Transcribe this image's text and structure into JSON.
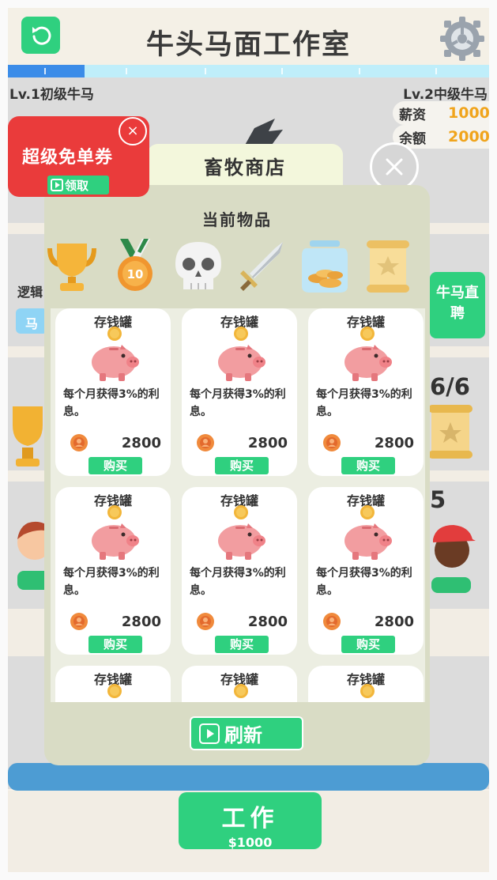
{
  "header": {
    "title": "牛头马面工作室",
    "back_icon": "undo-arrow-icon",
    "settings_icon": "gear-icon",
    "progress": 0.16
  },
  "levels": {
    "current": "Lv.1初级牛马",
    "next": "Lv.2中级牛马"
  },
  "stats": [
    {
      "label": "薪资",
      "value": "1000"
    },
    {
      "label": "余额",
      "value": "2000"
    }
  ],
  "background": {
    "left_label": "逻辑",
    "left_pill": "马",
    "right_button": "牛马直聘",
    "count_a": "6/6",
    "count_b": "5"
  },
  "coupon": {
    "title": "超级免单券",
    "claim": "领取",
    "close": "×"
  },
  "shop": {
    "tab_title": "畜牧商店",
    "current_items_title": "当前物品",
    "owned_items": [
      "trophy-icon",
      "medal-10-icon",
      "skull-icon",
      "sword-icon",
      "coin-jar-icon",
      "scroll-icon"
    ],
    "medal_number": "10",
    "cards": [
      {
        "name": "存钱罐",
        "desc": "每个月获得3%的利息。",
        "price": "2800",
        "buy": "购买"
      },
      {
        "name": "存钱罐",
        "desc": "每个月获得3%的利息。",
        "price": "2800",
        "buy": "购买"
      },
      {
        "name": "存钱罐",
        "desc": "每个月获得3%的利息。",
        "price": "2800",
        "buy": "购买"
      },
      {
        "name": "存钱罐",
        "desc": "每个月获得3%的利息。",
        "price": "2800",
        "buy": "购买"
      },
      {
        "name": "存钱罐",
        "desc": "每个月获得3%的利息。",
        "price": "2800",
        "buy": "购买"
      },
      {
        "name": "存钱罐",
        "desc": "每个月获得3%的利息。",
        "price": "2800",
        "buy": "购买"
      },
      {
        "name": "存钱罐",
        "desc": "",
        "price": "",
        "buy": ""
      },
      {
        "name": "存钱罐",
        "desc": "",
        "price": "",
        "buy": ""
      },
      {
        "name": "存钱罐",
        "desc": "",
        "price": "",
        "buy": ""
      }
    ],
    "refresh": "刷新"
  },
  "work": {
    "label": "工作",
    "salary": "$1000"
  },
  "colors": {
    "accent_green": "#2fd07f",
    "coupon_red": "#ea3b3b",
    "coin_gold": "#f0a41c",
    "progress_blue": "#3b8ce8"
  }
}
